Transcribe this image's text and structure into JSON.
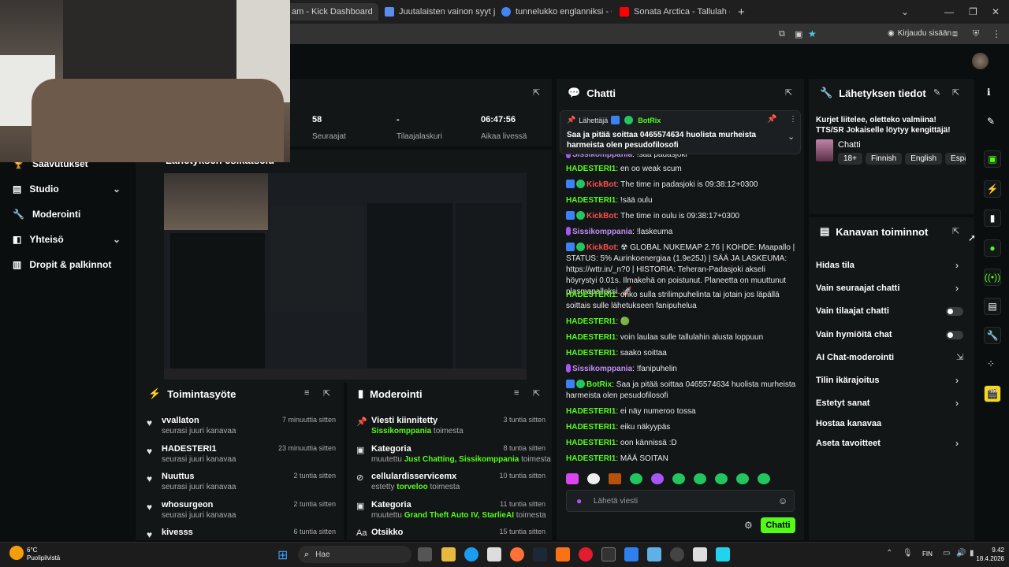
{
  "browser": {
    "tabs": [
      {
        "label": "am - Kick Dashboard",
        "color": "#53fc18"
      },
      {
        "label": "Juutalaisten vainon syyt ja aika",
        "color": "#5b8def"
      },
      {
        "label": "tunnelukko englanniksi - Googl",
        "color": "#4285f4"
      },
      {
        "label": "Sonata Arctica - Tallulah - YouT",
        "color": "#ff0000"
      }
    ],
    "new_tab": "+",
    "sign_in": "Kirjaudu sisään"
  },
  "stats": [
    {
      "value": "58",
      "label": "Seuraajat"
    },
    {
      "value": "-",
      "label": "Tilaajalaskuri"
    },
    {
      "value": "06:47:56",
      "label": "Aikaa livessä"
    }
  ],
  "preview_title": "Lähetyksen esikatselu",
  "nav": [
    {
      "label": "Saavutukset",
      "chevron": false
    },
    {
      "label": "Studio",
      "chevron": true
    },
    {
      "label": "Moderointi",
      "chevron": false
    },
    {
      "label": "Yhteisö",
      "chevron": true
    },
    {
      "label": "Dropit & palkinnot",
      "chevron": false
    }
  ],
  "activity": {
    "title": "Toimintasyöte",
    "items": [
      {
        "name": "vvallaton",
        "sub": "seurasi juuri kanavaa",
        "time": "7 minuuttia sitten"
      },
      {
        "name": "HADESTERI1",
        "sub": "seurasi juuri kanavaa",
        "time": "23 minuuttia sitten"
      },
      {
        "name": "Nuuttus",
        "sub": "seurasi juuri kanavaa",
        "time": "2 tuntia sitten"
      },
      {
        "name": "whosurgeon",
        "sub": "seurasi juuri kanavaa",
        "time": "2 tuntia sitten"
      },
      {
        "name": "kivesss",
        "sub": "",
        "time": "6 tuntia sitten"
      }
    ]
  },
  "moderation": {
    "title": "Moderointi",
    "items": [
      {
        "title": "Viesti kiinnitetty",
        "pre": "",
        "hl": "Sissikomppania",
        "post": " toimesta",
        "time": "3 tuntia sitten"
      },
      {
        "title": "Kategoria",
        "pre": "muutettu ",
        "hl": "Just Chatting, Sissikomppania",
        "post": " toimesta",
        "time": "8 tuntia sitten"
      },
      {
        "title": "cellulardisservicemx",
        "pre": "estetty ",
        "hl": "torveloo",
        "post": " toimesta",
        "time": "10 tuntia sitten"
      },
      {
        "title": "Kategoria",
        "pre": "muutettu ",
        "hl": "Grand Theft Auto IV, StarlieAI",
        "post": " toimesta",
        "time": "11 tuntia sitten"
      },
      {
        "title": "Otsikko",
        "pre": "",
        "hl": "",
        "post": "",
        "time": "15 tuntia sitten"
      }
    ]
  },
  "chat": {
    "title": "Chatti",
    "pinned_by": "Lähettäjä",
    "pinned_user": "BotRix",
    "pinned_text": "Saa ja pitää soittaa 0465574634 huolista murheista harmeista olen pesudofilosofi",
    "messages": [
      {
        "user": "Sissikomppania",
        "cls": "purple",
        "text": ": !saa padasjoki",
        "badges": [
          "mic"
        ]
      },
      {
        "user": "HADESTERI1",
        "cls": "",
        "text": ": en oo weak scum",
        "badges": []
      },
      {
        "user": "KickBot",
        "cls": "red",
        "text": ": The time in padasjoki is 09:38:12+0300",
        "badges": [
          "blue",
          "green"
        ]
      },
      {
        "user": "HADESTERI1",
        "cls": "",
        "text": ": !sää oulu",
        "badges": []
      },
      {
        "user": "KickBot",
        "cls": "red",
        "text": ": The time in oulu is 09:38:17+0300",
        "badges": [
          "blue",
          "green"
        ]
      },
      {
        "user": "Sissikomppania",
        "cls": "purple",
        "text": ": !laskeuma",
        "badges": [
          "mic"
        ]
      },
      {
        "user": "KickBot",
        "cls": "red",
        "text": ": ☢ GLOBAL NUKEMAP 2.76 | KOHDE: Maapallo | STATUS: 5% Aurinkoenergiaa (1.9e25J) | SÄÄ JA LASKEUMA: https://wttr.in/_n?0 | HISTORIA: Teheran-Padasjoki akseli höyrystyi 0.01s. Ilmakehä on poistunut. Planeetta on muuttunut plasmapalloksi. 🚀",
        "badges": [
          "blue",
          "green"
        ]
      },
      {
        "user": "HADESTERI1",
        "cls": "",
        "text": ": onko sulla strilimpuhelinta tai jotain jos läpällä soittais sulle lähetukseen fanipuhelua",
        "badges": []
      },
      {
        "user": "HADESTERI1",
        "cls": "",
        "text": ": 🟢",
        "badges": []
      },
      {
        "user": "HADESTERI1",
        "cls": "",
        "text": ": voin laulaa sulle tallulahin alusta loppuun",
        "badges": []
      },
      {
        "user": "HADESTERI1",
        "cls": "",
        "text": ": saako soittaa",
        "badges": []
      },
      {
        "user": "Sissikomppania",
        "cls": "purple",
        "text": ": !fanipuhelin",
        "badges": [
          "mic"
        ]
      },
      {
        "user": "BotRix",
        "cls": "",
        "text": ": Saa ja pitää soittaa 0465574634 huolista murheista harmeista olen pesudofilosofi",
        "badges": [
          "blue",
          "green"
        ]
      },
      {
        "user": "HADESTERI1",
        "cls": "",
        "text": ": ei näy numeroo tossa",
        "badges": []
      },
      {
        "user": "HADESTERI1",
        "cls": "",
        "text": ": eiku näkyypäs",
        "badges": []
      },
      {
        "user": "HADESTERI1",
        "cls": "",
        "text": ": oon kännissä :D",
        "badges": []
      },
      {
        "user": "HADESTERI1",
        "cls": "",
        "text": ": MÄÄ SOITAN",
        "badges": []
      }
    ],
    "input_placeholder": "Lähetä viesti",
    "send_label": "Chatti"
  },
  "stream_info": {
    "title": "Lähetyksen tiedot",
    "text": "Kurjet liitelee, oletteko valmiina! TTS/SR Jokaiselle löytyy kengittäjä!",
    "category": "Chatti",
    "tags": [
      "18+",
      "Finnish",
      "English",
      "Españ"
    ]
  },
  "channel_actions": {
    "title": "Kanavan toiminnot",
    "items": [
      {
        "label": "Hidas tila",
        "type": "chevron"
      },
      {
        "label": "Vain seuraajat chatti",
        "type": "chevron"
      },
      {
        "label": "Vain tilaajat chatti",
        "type": "toggle"
      },
      {
        "label": "Vain hymiöitä chat",
        "type": "toggle"
      },
      {
        "label": "AI Chat-moderointi",
        "type": "external"
      },
      {
        "label": "Tilin ikärajoitus",
        "type": "chevron"
      },
      {
        "label": "Estetyt sanat",
        "type": "chevron"
      },
      {
        "label": "Hostaa kanavaa",
        "type": "none"
      },
      {
        "label": "Aseta tavoitteet",
        "type": "chevron"
      }
    ]
  },
  "taskbar": {
    "temp": "6°C",
    "weather": "Puolipilvistä",
    "search": "Hae",
    "lang": "FIN",
    "time": "9.42",
    "date": "18.4.2026"
  }
}
